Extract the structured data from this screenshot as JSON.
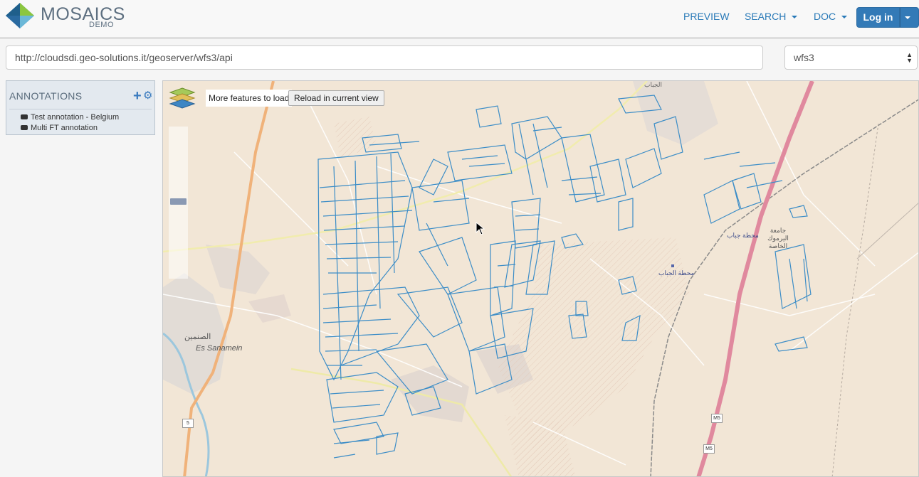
{
  "header": {
    "brand": "MOSAICS",
    "brand_sub": "DEMO",
    "nav": {
      "preview": "PREVIEW",
      "search": "SEARCH",
      "doc": "DOC"
    },
    "login_label": "Log in"
  },
  "service": {
    "url": "http://cloudsdi.geo-solutions.it/geoserver/wfs3/api",
    "protocol_selected": "wfs3"
  },
  "annotations": {
    "title": "ANNOTATIONS",
    "items": [
      {
        "label": "Test annotation - Belgium"
      },
      {
        "label": "Multi FT annotation"
      }
    ]
  },
  "map": {
    "more_features_text": "More features to load",
    "reload_label": "Reload in current view",
    "zoom_level_fraction": 0.5,
    "labels": {
      "town_en": "Es Sanamein",
      "town_ar": "الصنمين",
      "station_ar": "محطة الجباب",
      "station2_ar": "محطة جباب",
      "university_ar": "جامعة اليرموك الخاصة",
      "top_ar": "الجباب"
    },
    "road_shields": [
      "5",
      "M5",
      "M5"
    ]
  },
  "colors": {
    "accent": "#337ab7",
    "feature_stroke": "#3c8dc7",
    "motorway": "#e0899e",
    "basemap": "#f1e8dc"
  }
}
